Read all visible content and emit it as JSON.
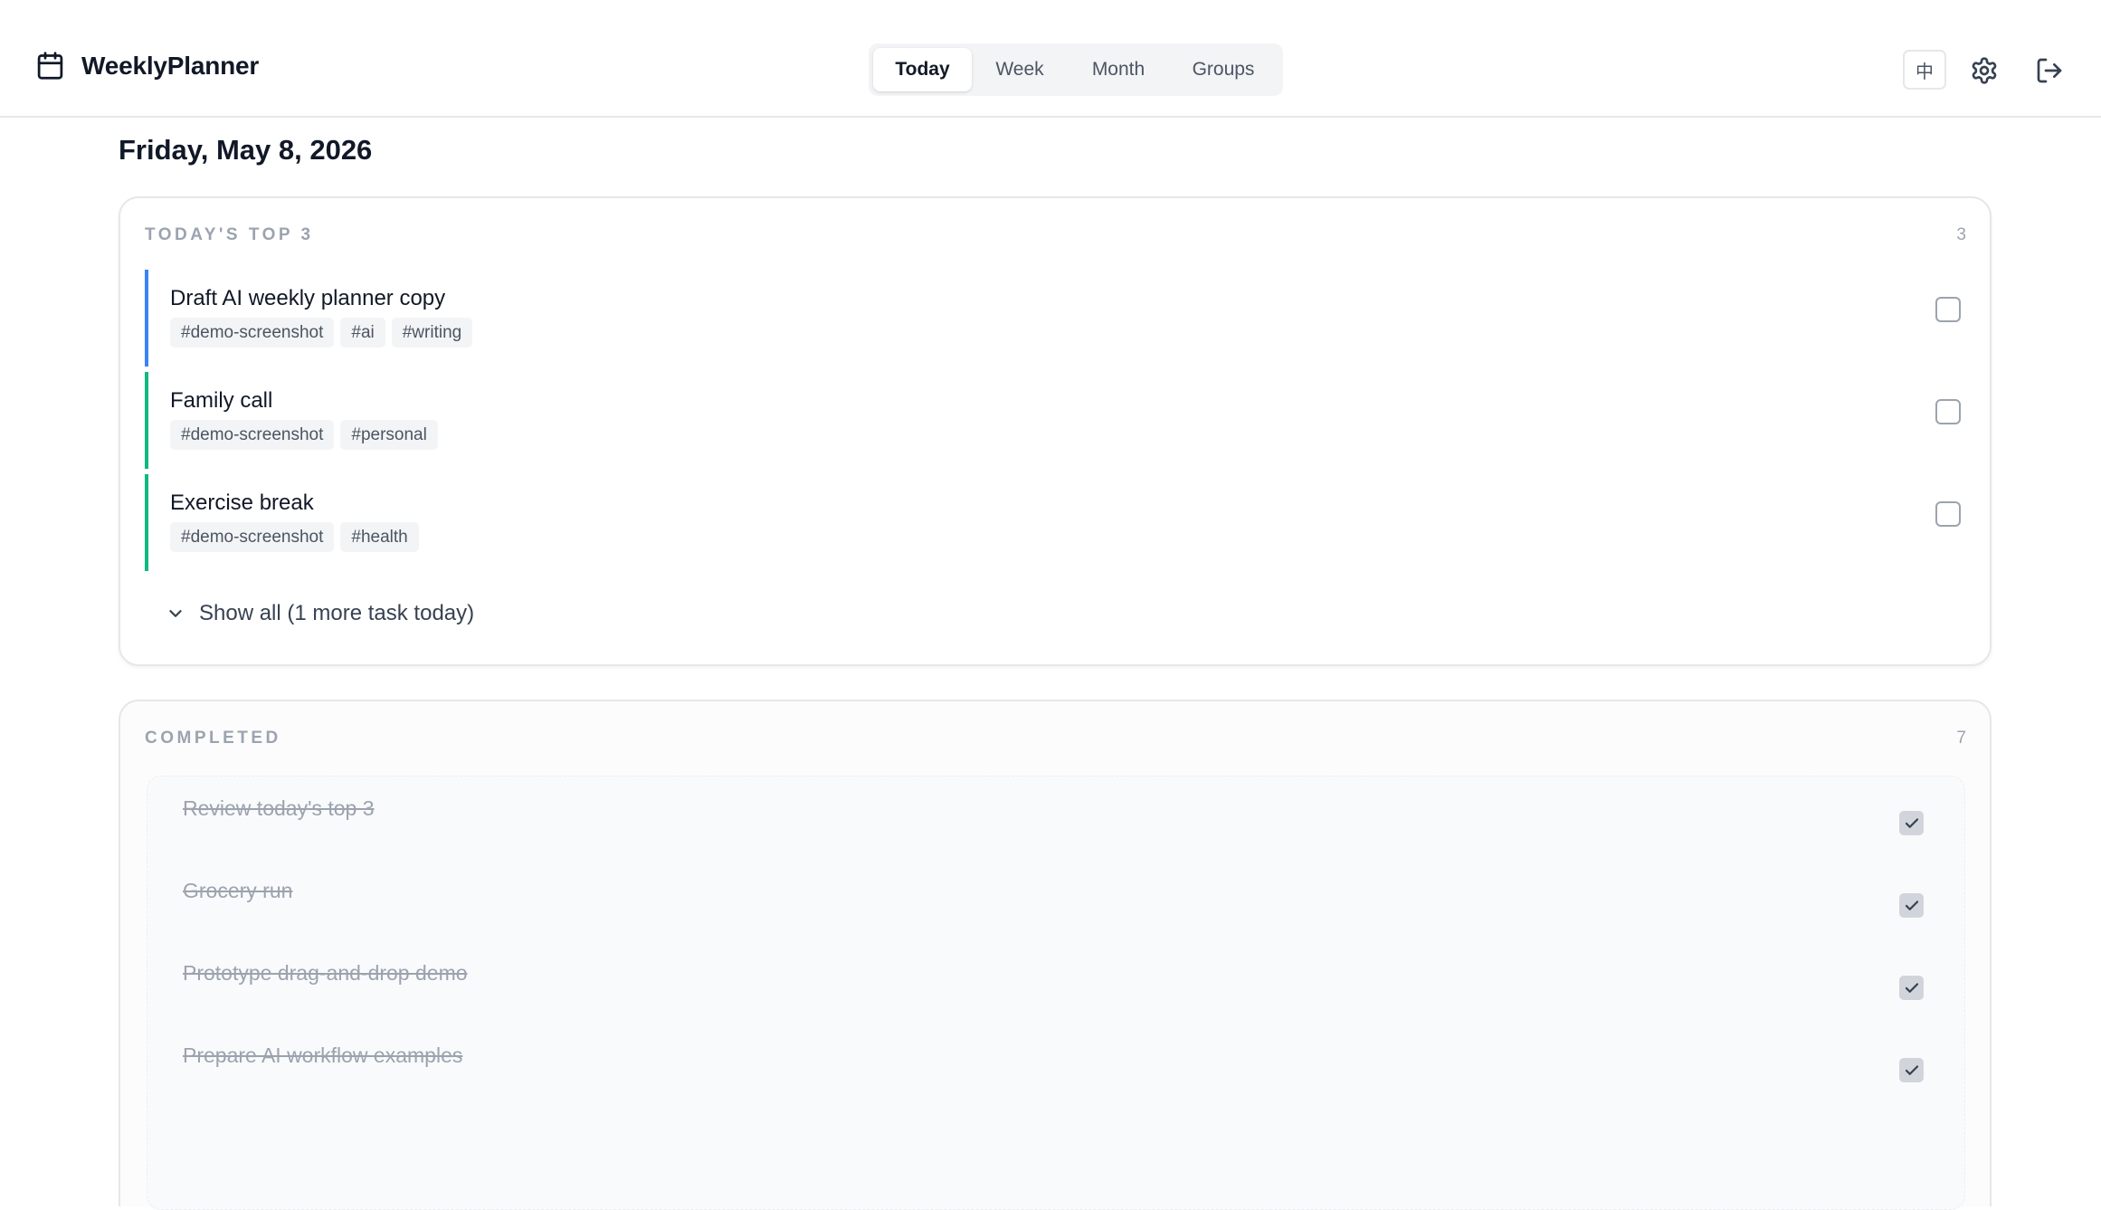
{
  "app": {
    "name": "WeeklyPlanner",
    "icon": "calendar-icon"
  },
  "nav": {
    "tabs": [
      {
        "label": "Today",
        "active": true
      },
      {
        "label": "Week",
        "active": false
      },
      {
        "label": "Month",
        "active": false
      },
      {
        "label": "Groups",
        "active": false
      }
    ]
  },
  "header_actions": {
    "language_label": "中",
    "settings_icon": "gear-icon",
    "logout_icon": "logout-icon"
  },
  "page": {
    "date_title": "Friday, May 8, 2026"
  },
  "top3": {
    "label": "TODAY'S TOP 3",
    "count": "3",
    "tasks": [
      {
        "title": "Draft AI weekly planner copy",
        "tags": [
          "#demo-screenshot",
          "#ai",
          "#writing"
        ],
        "accent": "#3b82f6",
        "done": false
      },
      {
        "title": "Family call",
        "tags": [
          "#demo-screenshot",
          "#personal"
        ],
        "accent": "#10b981",
        "done": false
      },
      {
        "title": "Exercise break",
        "tags": [
          "#demo-screenshot",
          "#health"
        ],
        "accent": "#10b981",
        "done": false
      }
    ],
    "show_all_label": "Show all (1 more task today)"
  },
  "completed": {
    "label": "COMPLETED",
    "count": "7",
    "tasks": [
      {
        "title": "Review today's top 3",
        "done": true
      },
      {
        "title": "Grocery run",
        "done": true
      },
      {
        "title": "Prototype drag-and-drop demo",
        "done": true
      },
      {
        "title": "Prepare AI workflow examples",
        "done": true
      }
    ]
  },
  "colors": {
    "accent_blue": "#3b82f6",
    "accent_green": "#10b981",
    "muted_text": "#9ca3af"
  }
}
